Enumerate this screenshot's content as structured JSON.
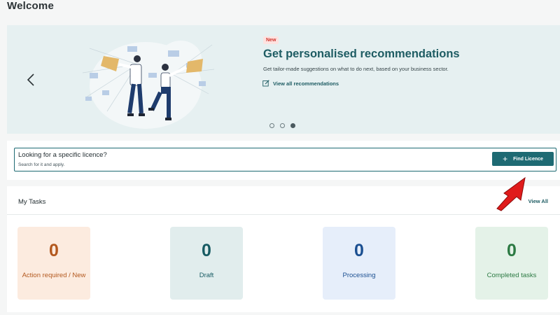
{
  "page": {
    "title": "Welcome"
  },
  "banner": {
    "badge": "New",
    "title": "Get personalised recommendations",
    "subtitle": "Get tailor-made suggestions on what to do next, based on your business sector.",
    "link_label": "View all recommendations",
    "slides_total": 3,
    "active_slide": 3,
    "colors": {
      "background": "#e6f0f1",
      "accent": "#1e5c63",
      "badge": "#d0342c"
    }
  },
  "licence_search": {
    "title": "Looking for a specific licence?",
    "subtitle": "Search for it and apply.",
    "button_label": "Find Licence",
    "button_icon": "plus-icon",
    "colors": {
      "accent": "#1e6a73"
    }
  },
  "tasks": {
    "title": "My Tasks",
    "view_all_label": "View All",
    "cards": [
      {
        "count": "0",
        "label": "Action required / New",
        "color": "#b3581e"
      },
      {
        "count": "0",
        "label": "Draft",
        "color": "#175b63"
      },
      {
        "count": "0",
        "label": "Processing",
        "color": "#1b4f91"
      },
      {
        "count": "0",
        "label": "Completed tasks",
        "color": "#2c7a43"
      }
    ]
  },
  "annotation": {
    "icon": "red-arrow-icon",
    "color": "#e01b1b"
  }
}
